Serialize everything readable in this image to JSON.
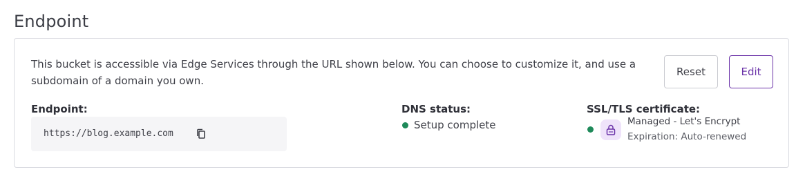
{
  "section": {
    "title": "Endpoint"
  },
  "card": {
    "description": "This bucket is accessible via Edge Services through the URL shown below. You can choose to customize it, and use a subdomain of a domain you own.",
    "reset_label": "Reset",
    "edit_label": "Edit"
  },
  "endpoint": {
    "label": "Endpoint:",
    "url": "https://blog.example.com",
    "copy_icon": "copy-icon"
  },
  "dns": {
    "label": "DNS status:",
    "status": "Setup complete",
    "status_color": "#1f8a5a"
  },
  "ssl": {
    "label": "SSL/TLS certificate:",
    "managed": "Managed - Let's Encrypt",
    "expiration": "Expiration: Auto-renewed",
    "status_color": "#1f8a5a",
    "lock_icon": "lock-icon",
    "lock_badge_color": "#efe3fa"
  },
  "colors": {
    "accent": "#6a32a8",
    "border": "#d9dae0",
    "text": "#3f4048"
  }
}
